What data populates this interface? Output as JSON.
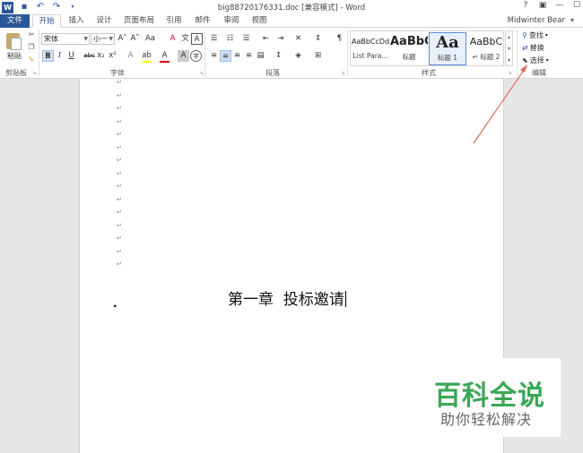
{
  "window": {
    "title": "big88720176331.doc [兼容模式] - Word",
    "controls": [
      "?",
      "▣",
      "—",
      "☐"
    ],
    "user": "Midwinter Bear"
  },
  "tabs": [
    {
      "label": "文件"
    },
    {
      "label": "开始"
    },
    {
      "label": "插入"
    },
    {
      "label": "设计"
    },
    {
      "label": "页面布局"
    },
    {
      "label": "引用"
    },
    {
      "label": "邮件"
    },
    {
      "label": "审阅"
    },
    {
      "label": "视图"
    }
  ],
  "active_tab": "开始",
  "ribbon": {
    "clipboard": {
      "paste_label": "粘贴",
      "group_label": "剪贴板"
    },
    "font": {
      "font_name": "宋体",
      "font_size": "小一",
      "group_label": "字体",
      "buttons": {
        "bold": "B",
        "italic": "I",
        "underline": "U",
        "strike": "abc",
        "subscript": "x₂",
        "superscript": "x²",
        "grow": "A˄",
        "shrink": "A˅",
        "case": "Aa",
        "clear": "A",
        "phonetic": "文",
        "border": "A",
        "effects": "A",
        "highlight": "ab",
        "color": "A",
        "shade": "A",
        "enclose": "字"
      }
    },
    "paragraph": {
      "group_label": "段落",
      "sort": "↕",
      "marks": "¶"
    },
    "styles": {
      "group_label": "样式",
      "items": [
        {
          "sample": "AaBbCcDd",
          "name": "List Para..."
        },
        {
          "sample": "AaBbC",
          "name": "标题"
        },
        {
          "sample": "Aa",
          "name": "标题 1"
        },
        {
          "sample": "AaBbC",
          "name": "↵ 标题 2"
        }
      ]
    },
    "editing": {
      "group_label": "编辑",
      "find": "查找",
      "replace": "替换",
      "select": "选择"
    }
  },
  "document": {
    "paragraph_mark": "↵",
    "heading": "第一章  投标邀请",
    "bullet": "."
  },
  "watermark": {
    "title": "百科全说",
    "subtitle": "助你轻松解决"
  },
  "colors": {
    "brand": "#2b579a",
    "annotation_arrow": "#e06b5a",
    "watermark_green": "#3aa757"
  }
}
